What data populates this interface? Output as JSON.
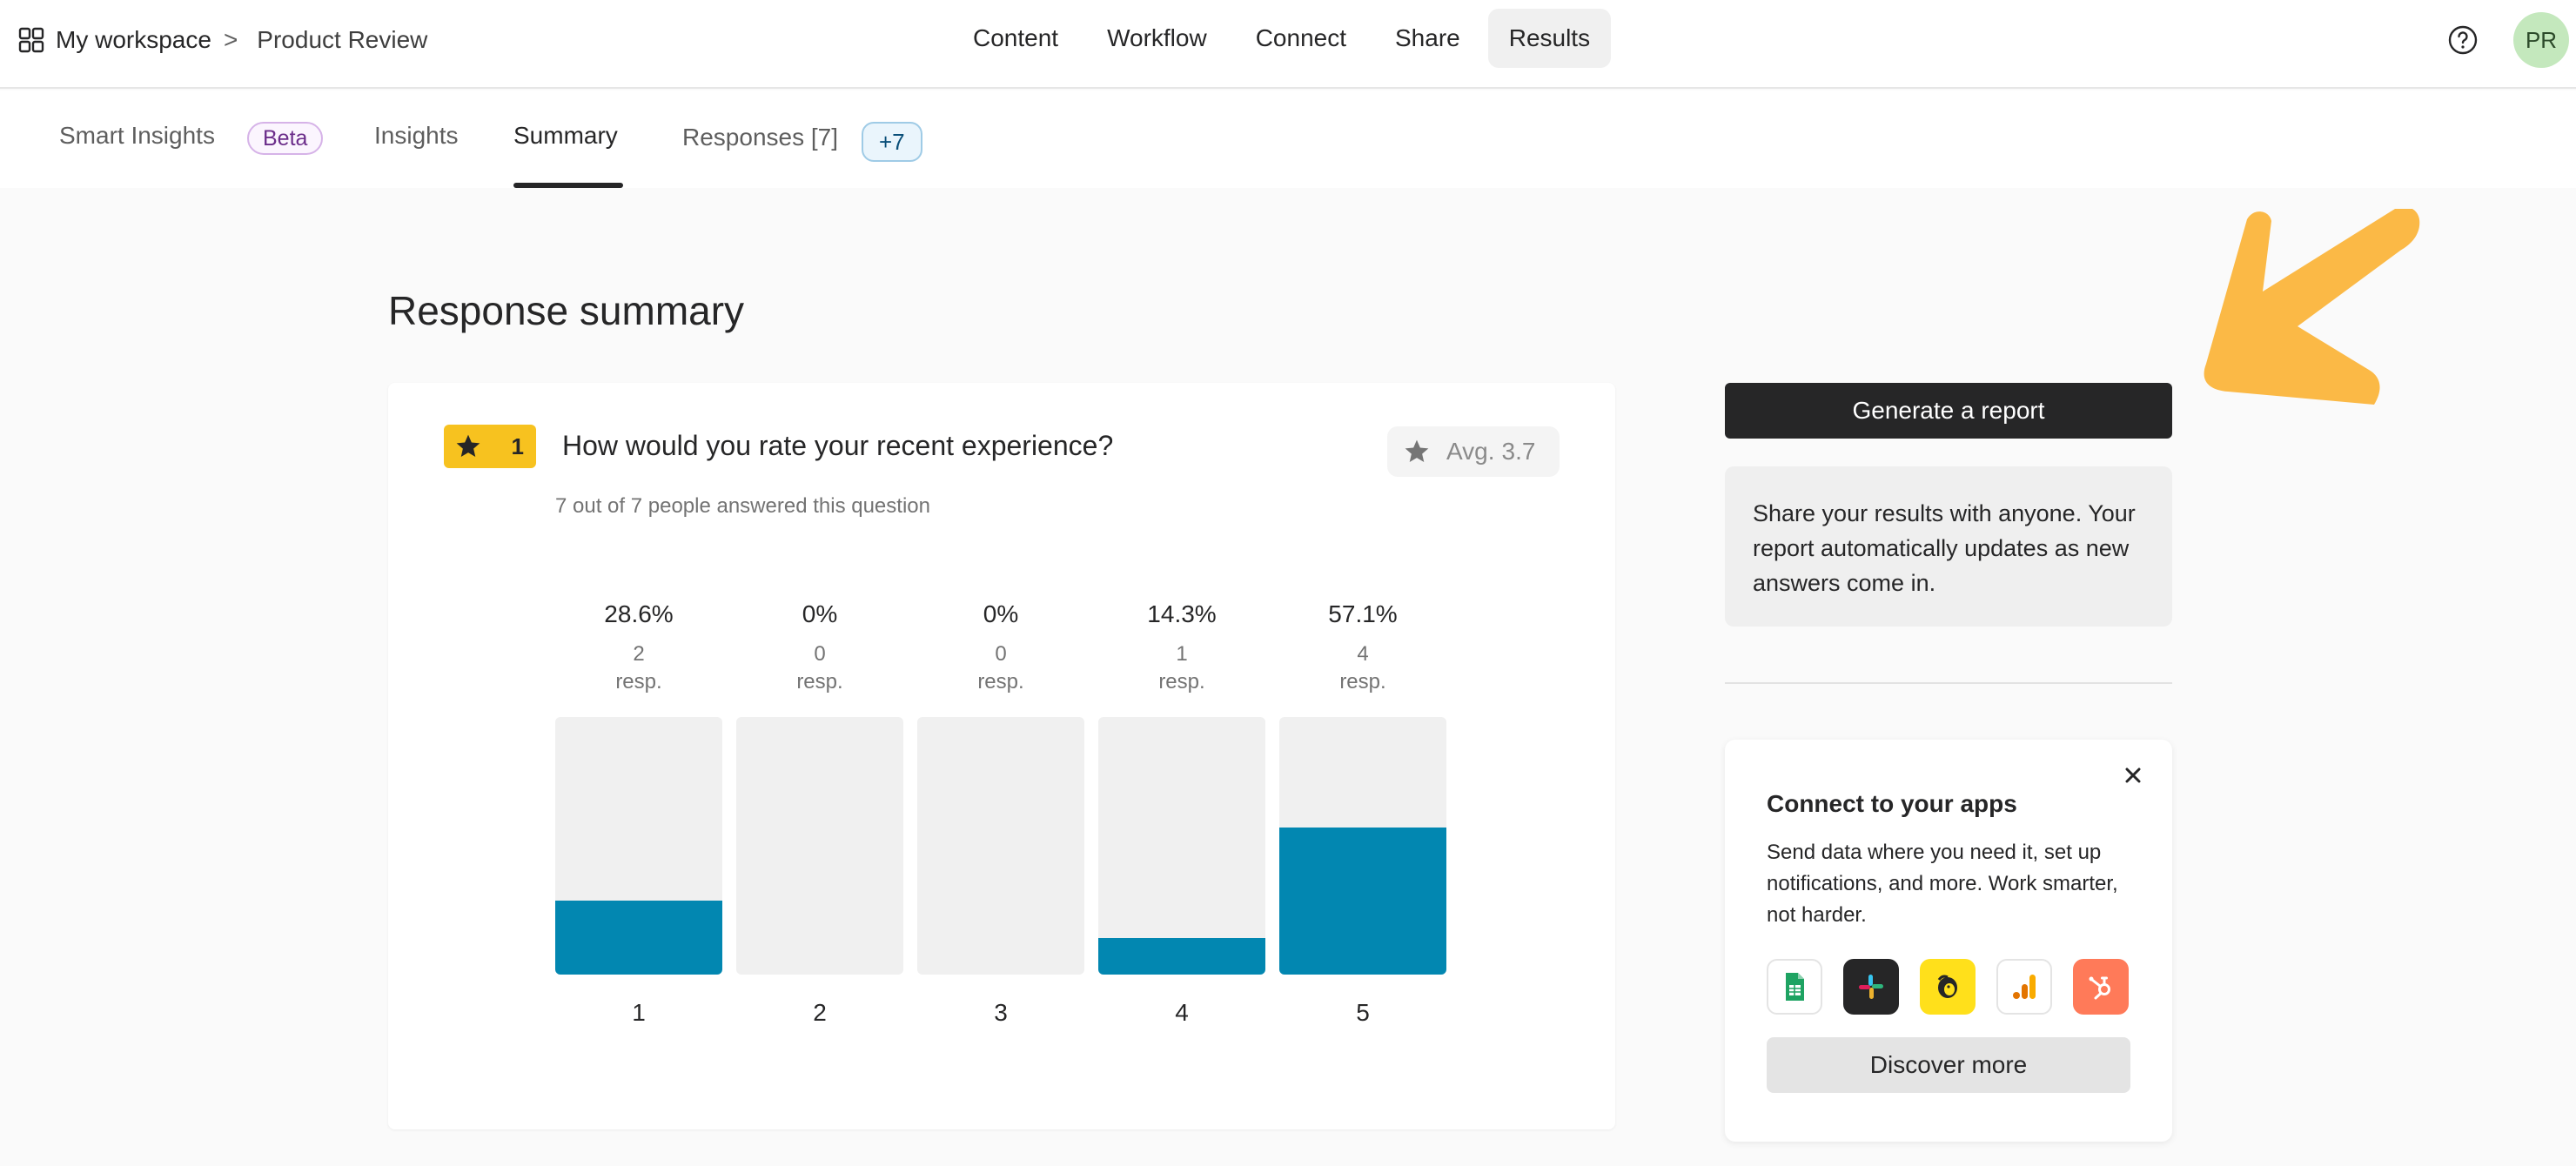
{
  "topbar": {
    "breadcrumb": {
      "workspace": "My workspace",
      "separator": ">",
      "form": "Product Review"
    },
    "nav": [
      {
        "label": "Content",
        "active": false
      },
      {
        "label": "Workflow",
        "active": false
      },
      {
        "label": "Connect",
        "active": false
      },
      {
        "label": "Share",
        "active": false
      },
      {
        "label": "Results",
        "active": true
      }
    ],
    "avatar_initials": "PR"
  },
  "subtabs": {
    "smart_insights": "Smart Insights",
    "beta_badge": "Beta",
    "insights": "Insights",
    "summary": "Summary",
    "responses": "Responses [7]",
    "new_badge": "+7",
    "active": "Summary"
  },
  "page": {
    "title": "Response summary"
  },
  "question": {
    "number": "1",
    "icon": "star-icon",
    "title": "How would you rate your recent experience?",
    "answered": "7 out of 7 people answered this question",
    "avg_label": "Avg.",
    "avg_value": "3.7"
  },
  "chart_data": {
    "type": "bar",
    "categories": [
      "1",
      "2",
      "3",
      "4",
      "5"
    ],
    "percent_labels": [
      "28.6%",
      "0%",
      "0%",
      "14.3%",
      "57.1%"
    ],
    "counts": [
      "2",
      "0",
      "0",
      "1",
      "4"
    ],
    "count_unit": "resp.",
    "values": [
      28.6,
      0,
      0,
      14.3,
      57.1
    ],
    "ylim": [
      0,
      100
    ],
    "bar_color": "#0287b1",
    "track_color": "#f0f0f0"
  },
  "report": {
    "button_label": "Generate a report",
    "info_text": "Share your results with anyone. Your report automatically updates as new answers come in."
  },
  "apps": {
    "title": "Connect to your apps",
    "description": "Send data where you need it, set up notifications, and more. Work smarter, not harder.",
    "icons": [
      "google-sheets-icon",
      "slack-icon",
      "mailchimp-icon",
      "google-analytics-icon",
      "hubspot-icon"
    ],
    "discover_label": "Discover more"
  },
  "colors": {
    "accent": "#0287b1",
    "question_badge": "#f7c21f",
    "arrow": "#fbb946",
    "button_dark": "#262627"
  }
}
